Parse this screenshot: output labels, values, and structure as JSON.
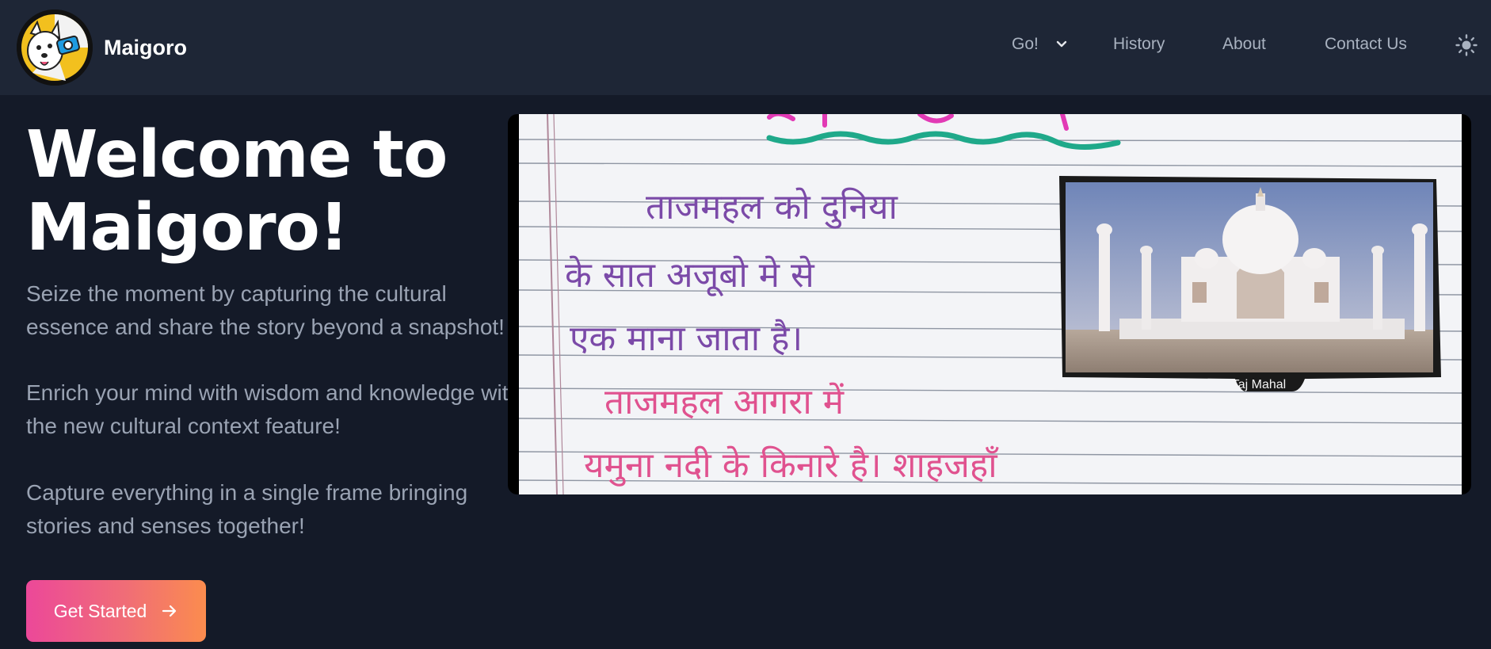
{
  "header": {
    "brand_name": "Maigoro",
    "nav": {
      "go_label": "Go!",
      "history_label": "History",
      "about_label": "About",
      "contact_label": "Contact Us"
    }
  },
  "hero": {
    "title_line1": "Welcome to",
    "title_line2": "Maigoro!",
    "paragraph1": "Seize the moment by capturing the cultural essence and share the story beyond a snapshot!",
    "paragraph2": "Enrich your mind with wisdom and knowledge with the new cultural context feature!",
    "paragraph3": "Capture everything in a single frame bringing stories and senses together!",
    "cta_label": "Get Started"
  },
  "image": {
    "handwriting_lines": [
      "ताजमहल को दुनिया",
      "के सात अजूबो मे से",
      "एक माना जाता है।",
      "ताजमहल आगरा में",
      "यमुना नदी के किनारे है। शाहजहाँ"
    ],
    "photo_caption": "Taj Mahal"
  },
  "colors": {
    "background": "#141a28",
    "navbar": "#1e2636",
    "cta_gradient_start": "#ec4899",
    "cta_gradient_end": "#fb8c4e"
  },
  "icons": {
    "logo": "dog-with-camera-logo",
    "go_chevron": "chevron-down-icon",
    "theme": "sun-icon",
    "cta_arrow": "arrow-right-icon"
  }
}
